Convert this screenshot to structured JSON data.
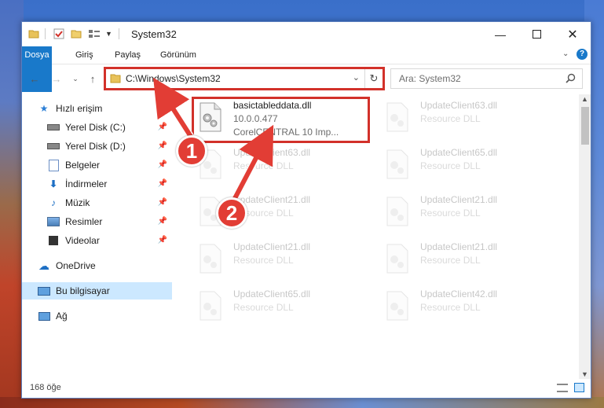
{
  "window": {
    "title": "System32"
  },
  "ribbon": {
    "tabs": [
      "Dosya",
      "Giriş",
      "Paylaş",
      "Görünüm"
    ]
  },
  "navigation": {
    "address": "C:\\Windows\\System32",
    "search_placeholder": "Ara: System32"
  },
  "sidebar": {
    "items": [
      {
        "label": "Hızlı erişim",
        "icon": "star-icon"
      },
      {
        "label": "Yerel Disk (C:)",
        "icon": "drive-icon",
        "pinned": true
      },
      {
        "label": "Yerel Disk (D:)",
        "icon": "drive-icon",
        "pinned": true
      },
      {
        "label": "Belgeler",
        "icon": "documents-icon",
        "pinned": true
      },
      {
        "label": "İndirmeler",
        "icon": "download-icon",
        "pinned": true
      },
      {
        "label": "Müzik",
        "icon": "music-icon",
        "pinned": true
      },
      {
        "label": "Resimler",
        "icon": "pictures-icon",
        "pinned": true
      },
      {
        "label": "Videolar",
        "icon": "video-icon",
        "pinned": true
      },
      {
        "label": "OneDrive",
        "icon": "cloud-icon"
      },
      {
        "label": "Bu bilgisayar",
        "icon": "computer-icon",
        "selected": true
      },
      {
        "label": "Ağ",
        "icon": "network-icon"
      }
    ]
  },
  "files": [
    {
      "name": "basictableddata.dll",
      "line2": "10.0.0.477",
      "line3": "CorelCENTRAL 10 Imp..."
    },
    {
      "name": "UpdateClient63.dll",
      "line2": "Resource DLL"
    },
    {
      "name": "UpdateClient63.dll",
      "line2": "Resource DLL"
    },
    {
      "name": "UpdateClient65.dll",
      "line2": "Resource DLL"
    },
    {
      "name": "UpdateClient21.dll",
      "line2": "Resource DLL"
    },
    {
      "name": "UpdateClient21.dll",
      "line2": "Resource DLL"
    },
    {
      "name": "UpdateClient21.dll",
      "line2": "Resource DLL"
    },
    {
      "name": "UpdateClient21.dll",
      "line2": "Resource DLL"
    },
    {
      "name": "UpdateClient65.dll",
      "line2": "Resource DLL"
    },
    {
      "name": "UpdateClient42.dll",
      "line2": "Resource DLL"
    }
  ],
  "status": {
    "item_count": "168 öğe"
  },
  "callouts": {
    "one": "1",
    "two": "2"
  },
  "colors": {
    "accent": "#1979ca",
    "highlight": "#d2312a",
    "callout": "#e23d35",
    "selected": "#cce8ff"
  }
}
